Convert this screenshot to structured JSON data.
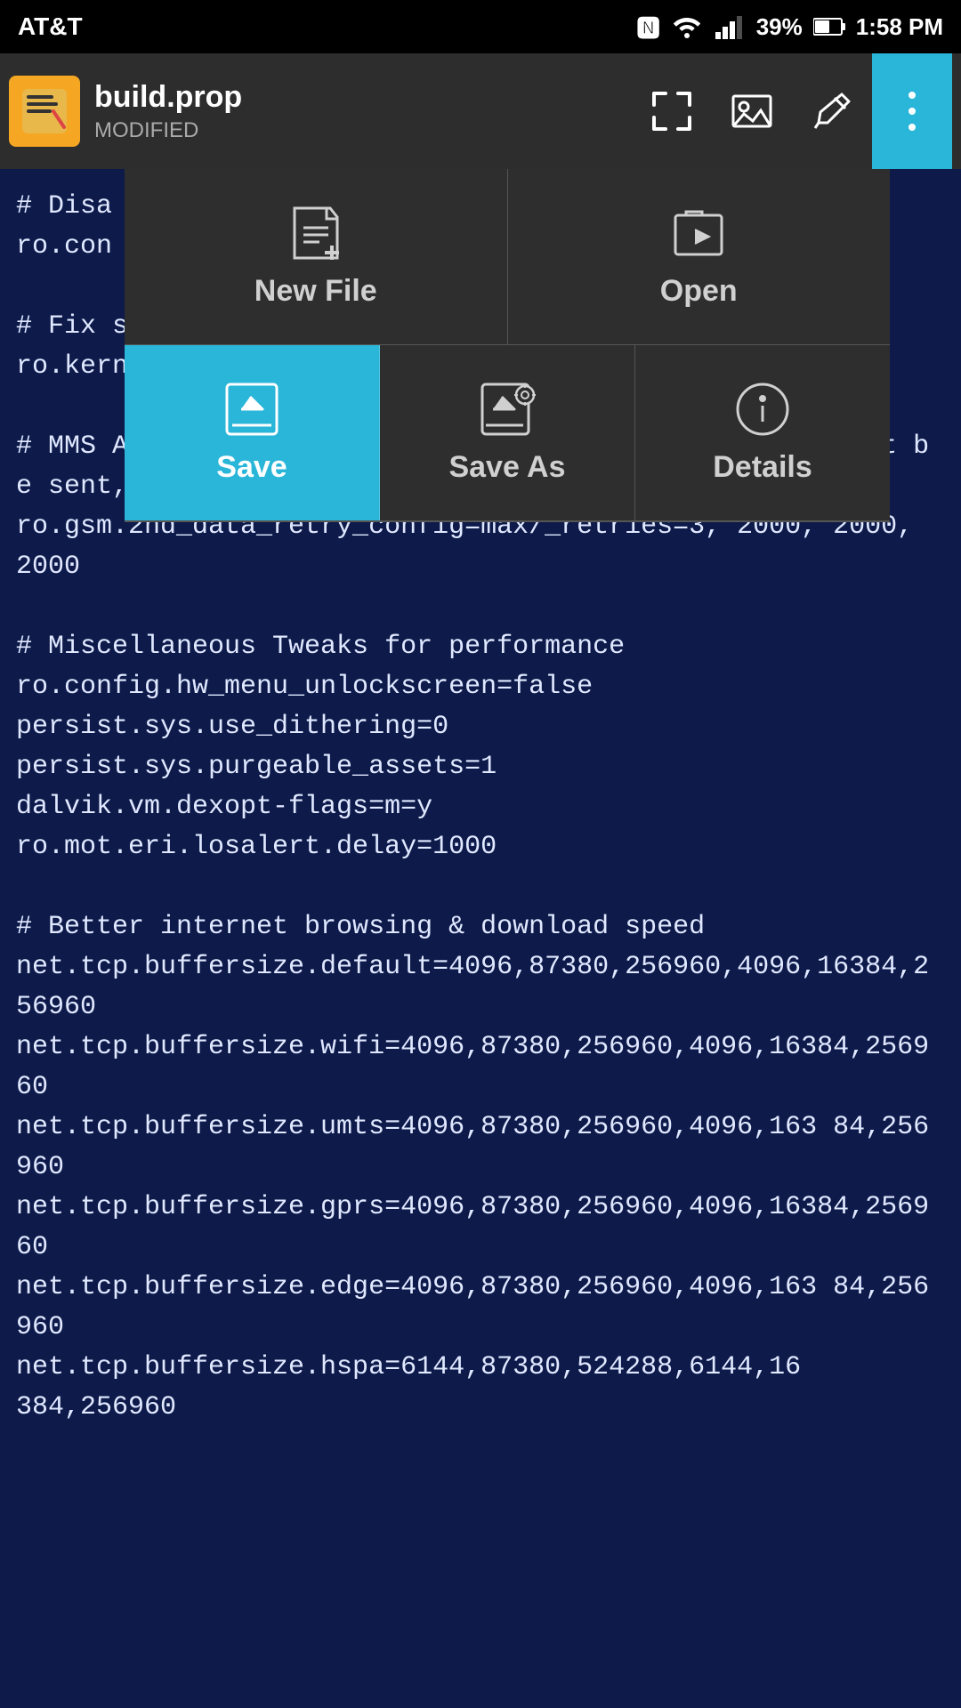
{
  "statusBar": {
    "carrier": "AT&T",
    "battery": "39%",
    "time": "1:58 PM"
  },
  "topBar": {
    "fileName": "build.prop",
    "fileStatus": "MODIFIED",
    "buttons": {
      "expand": "⤢",
      "image": "🖼",
      "pen": "✏",
      "more": "⋮"
    }
  },
  "menu": {
    "items": [
      {
        "id": "new-file",
        "label": "New File",
        "active": false
      },
      {
        "id": "open",
        "label": "Open",
        "active": false
      },
      {
        "id": "save",
        "label": "Save",
        "active": true
      },
      {
        "id": "save-as",
        "label": "Save As",
        "active": false
      },
      {
        "id": "details",
        "label": "Details",
        "active": false
      }
    ]
  },
  "editor": {
    "content": "# Disa\nro.con\n\n# Fix s\nro.kern\n\n# MMS APN retry timer set to 2 sec( If SMS/MMS couldn`t be sent, it retries after 2 instead of 5 seconds)\nro.gsm.2nd_data_retry_config=max/_retries=3, 2000, 2000, 2000\n\n# Miscellaneous Tweaks for performance\nro.config.hw_menu_unlockscreen=false\npersist.sys.use_dithering=0\npersist.sys.purgeable_assets=1\ndalvik.vm.dexopt-flags=m=y\nro.mot.eri.losalert.delay=1000\n\n# Better internet browsing & download speed\nnet.tcp.buffersize.default=4096,87380,256960,4096,16384,256960\nnet.tcp.buffersize.wifi=4096,87380,256960,4096,16384,256960\nnet.tcp.buffersize.umts=4096,87380,256960,4096,163 84,256960\nnet.tcp.buffersize.gprs=4096,87380,256960,4096,16384,256960\nnet.tcp.buffersize.edge=4096,87380,256960,4096,163 84,256960\nnet.tcp.buffersize.hspa=6144,87380,524288,6144,16\n384,256960"
  }
}
